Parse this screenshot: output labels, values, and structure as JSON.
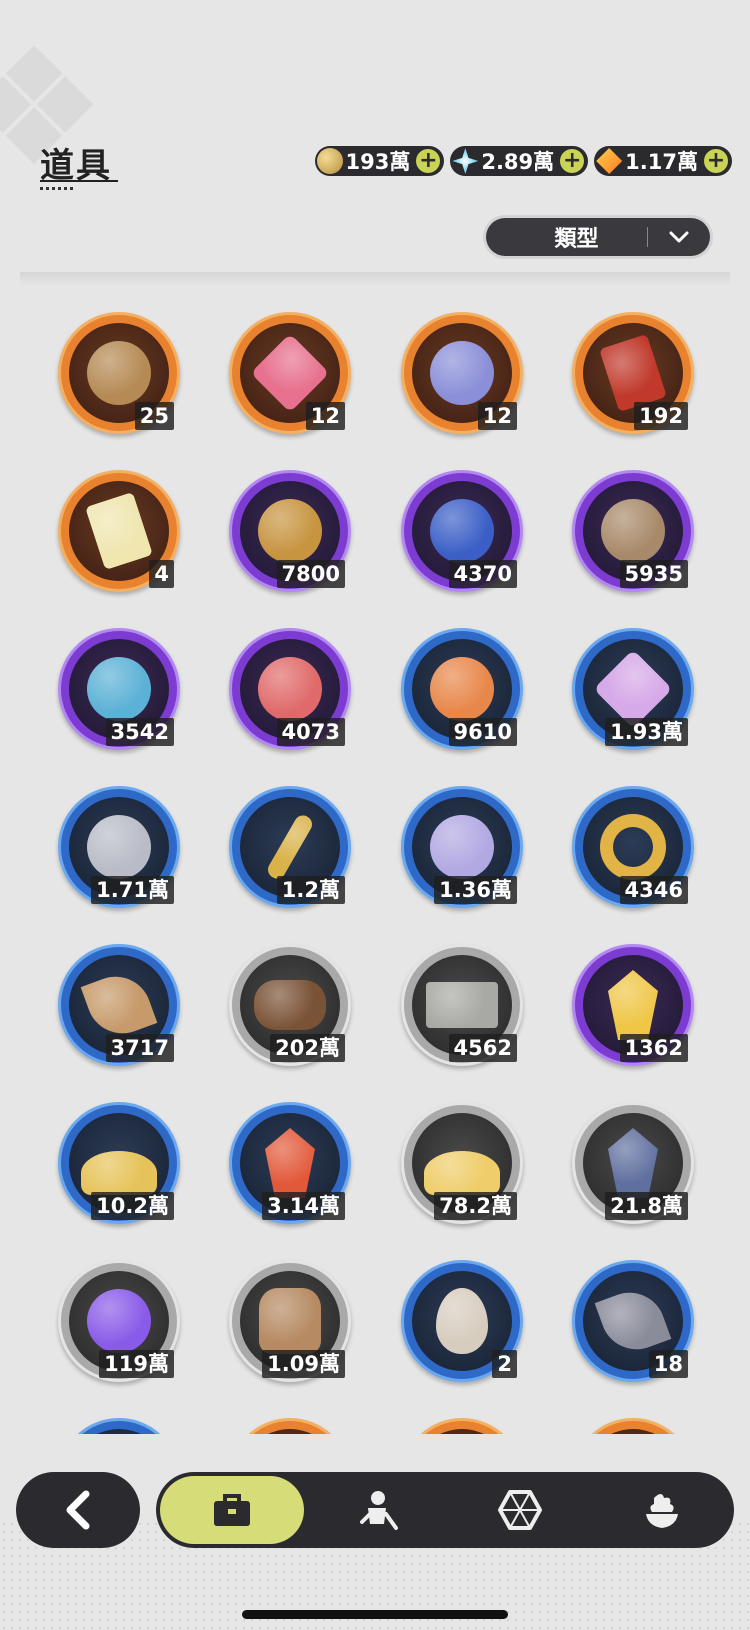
{
  "header": {
    "title": "道具"
  },
  "currencies": [
    {
      "icon": "gold-coin-icon",
      "value": "193萬"
    },
    {
      "icon": "star-crystal-icon",
      "value": "2.89萬"
    },
    {
      "icon": "orange-crystal-icon",
      "value": "1.17萬"
    }
  ],
  "filter": {
    "label": "類型"
  },
  "items": [
    {
      "name": "golden-emblem-item",
      "count": "25",
      "rarity": "orange",
      "shape": "circle",
      "color": "#b58a54"
    },
    {
      "name": "pink-gem-item",
      "count": "12",
      "rarity": "orange",
      "shape": "diamond",
      "color": "#e7718e"
    },
    {
      "name": "outfit-token-item",
      "count": "12",
      "rarity": "orange",
      "shape": "circle",
      "color": "#8b8fd8"
    },
    {
      "name": "wheel-ticket-item",
      "count": "192",
      "rarity": "orange",
      "shape": "card",
      "color": "#c0392b"
    },
    {
      "name": "rainbow-ticket-item",
      "count": "4",
      "rarity": "orange",
      "shape": "card",
      "color": "#efe6b0"
    },
    {
      "name": "trophy-medal-item",
      "count": "7800",
      "rarity": "purple",
      "shape": "circle",
      "color": "#c79440"
    },
    {
      "name": "star-moon-coin-item",
      "count": "4370",
      "rarity": "purple",
      "shape": "circle",
      "color": "#3b5fc7"
    },
    {
      "name": "fist-coin-item",
      "count": "5935",
      "rarity": "purple",
      "shape": "circle",
      "color": "#a88a6a"
    },
    {
      "name": "blue-rune-coin-item",
      "count": "3542",
      "rarity": "purple",
      "shape": "circle",
      "color": "#5bb1d6"
    },
    {
      "name": "heart-coin-item",
      "count": "4073",
      "rarity": "purple",
      "shape": "circle",
      "color": "#e06a6a"
    },
    {
      "name": "sun-star-coin-item",
      "count": "9610",
      "rarity": "blue",
      "shape": "circle",
      "color": "#e8874a"
    },
    {
      "name": "bunny-badge-item",
      "count": "1.93萬",
      "rarity": "blue",
      "shape": "diamond",
      "color": "#d6a9e8"
    },
    {
      "name": "silver-coin-item",
      "count": "1.71萬",
      "rarity": "blue",
      "shape": "circle",
      "color": "#b9bcc6"
    },
    {
      "name": "golden-blade-item",
      "count": "1.2萬",
      "rarity": "blue",
      "shape": "blade",
      "color": "#d9b24a"
    },
    {
      "name": "scale-shell-item",
      "count": "1.36萬",
      "rarity": "blue",
      "shape": "circle",
      "color": "#b2a9e2"
    },
    {
      "name": "golden-gear-item",
      "count": "4346",
      "rarity": "blue",
      "shape": "gear",
      "color": "#e2b446"
    },
    {
      "name": "leaf-item",
      "count": "3717",
      "rarity": "blue",
      "shape": "leaf",
      "color": "#c69a6a"
    },
    {
      "name": "wood-logs-item",
      "count": "202萬",
      "rarity": "gray",
      "shape": "logs",
      "color": "#7a5236"
    },
    {
      "name": "stone-blocks-item",
      "count": "4562",
      "rarity": "gray",
      "shape": "blocks",
      "color": "#a8a8a4"
    },
    {
      "name": "gold-crystal-item",
      "count": "1362",
      "rarity": "purple",
      "shape": "crystal",
      "color": "#efc646"
    },
    {
      "name": "gold-dust-pile-item",
      "count": "10.2萬",
      "rarity": "blue",
      "shape": "mound",
      "color": "#e6c35a"
    },
    {
      "name": "red-crystal-item",
      "count": "3.14萬",
      "rarity": "blue",
      "shape": "crystal",
      "color": "#e2593a"
    },
    {
      "name": "sand-pile-item",
      "count": "78.2萬",
      "rarity": "gray",
      "shape": "mound",
      "color": "#efcd6a"
    },
    {
      "name": "dark-crystal-item",
      "count": "21.8萬",
      "rarity": "gray",
      "shape": "crystal",
      "color": "#5f6f9e"
    },
    {
      "name": "purple-orb-item",
      "count": "119萬",
      "rarity": "gray",
      "shape": "circle",
      "color": "#8a5be8"
    },
    {
      "name": "food-bag-item",
      "count": "1.09萬",
      "rarity": "gray",
      "shape": "bag",
      "color": "#b68a62"
    },
    {
      "name": "egg-item",
      "count": "2",
      "rarity": "blue",
      "shape": "egg",
      "color": "#d7cdbf"
    },
    {
      "name": "feather-bundle-item",
      "count": "18",
      "rarity": "blue",
      "shape": "leaf",
      "color": "#8a8c9a"
    },
    {
      "name": "partial-item-1",
      "count": "",
      "rarity": "blue",
      "shape": "circle",
      "color": "#4b6fbf"
    },
    {
      "name": "partial-item-2",
      "count": "",
      "rarity": "orange",
      "shape": "circle",
      "color": "#c7743a"
    },
    {
      "name": "partial-item-3",
      "count": "",
      "rarity": "orange",
      "shape": "circle",
      "color": "#c7743a"
    },
    {
      "name": "partial-item-4",
      "count": "",
      "rarity": "orange",
      "shape": "circle",
      "color": "#c7743a"
    }
  ],
  "nav": {
    "back_icon": "back-arrow-icon",
    "tabs": [
      {
        "icon": "briefcase-icon",
        "active": true
      },
      {
        "icon": "character-sword-icon",
        "active": false
      },
      {
        "icon": "hexagon-gem-icon",
        "active": false
      },
      {
        "icon": "dessert-icon",
        "active": false
      }
    ]
  }
}
